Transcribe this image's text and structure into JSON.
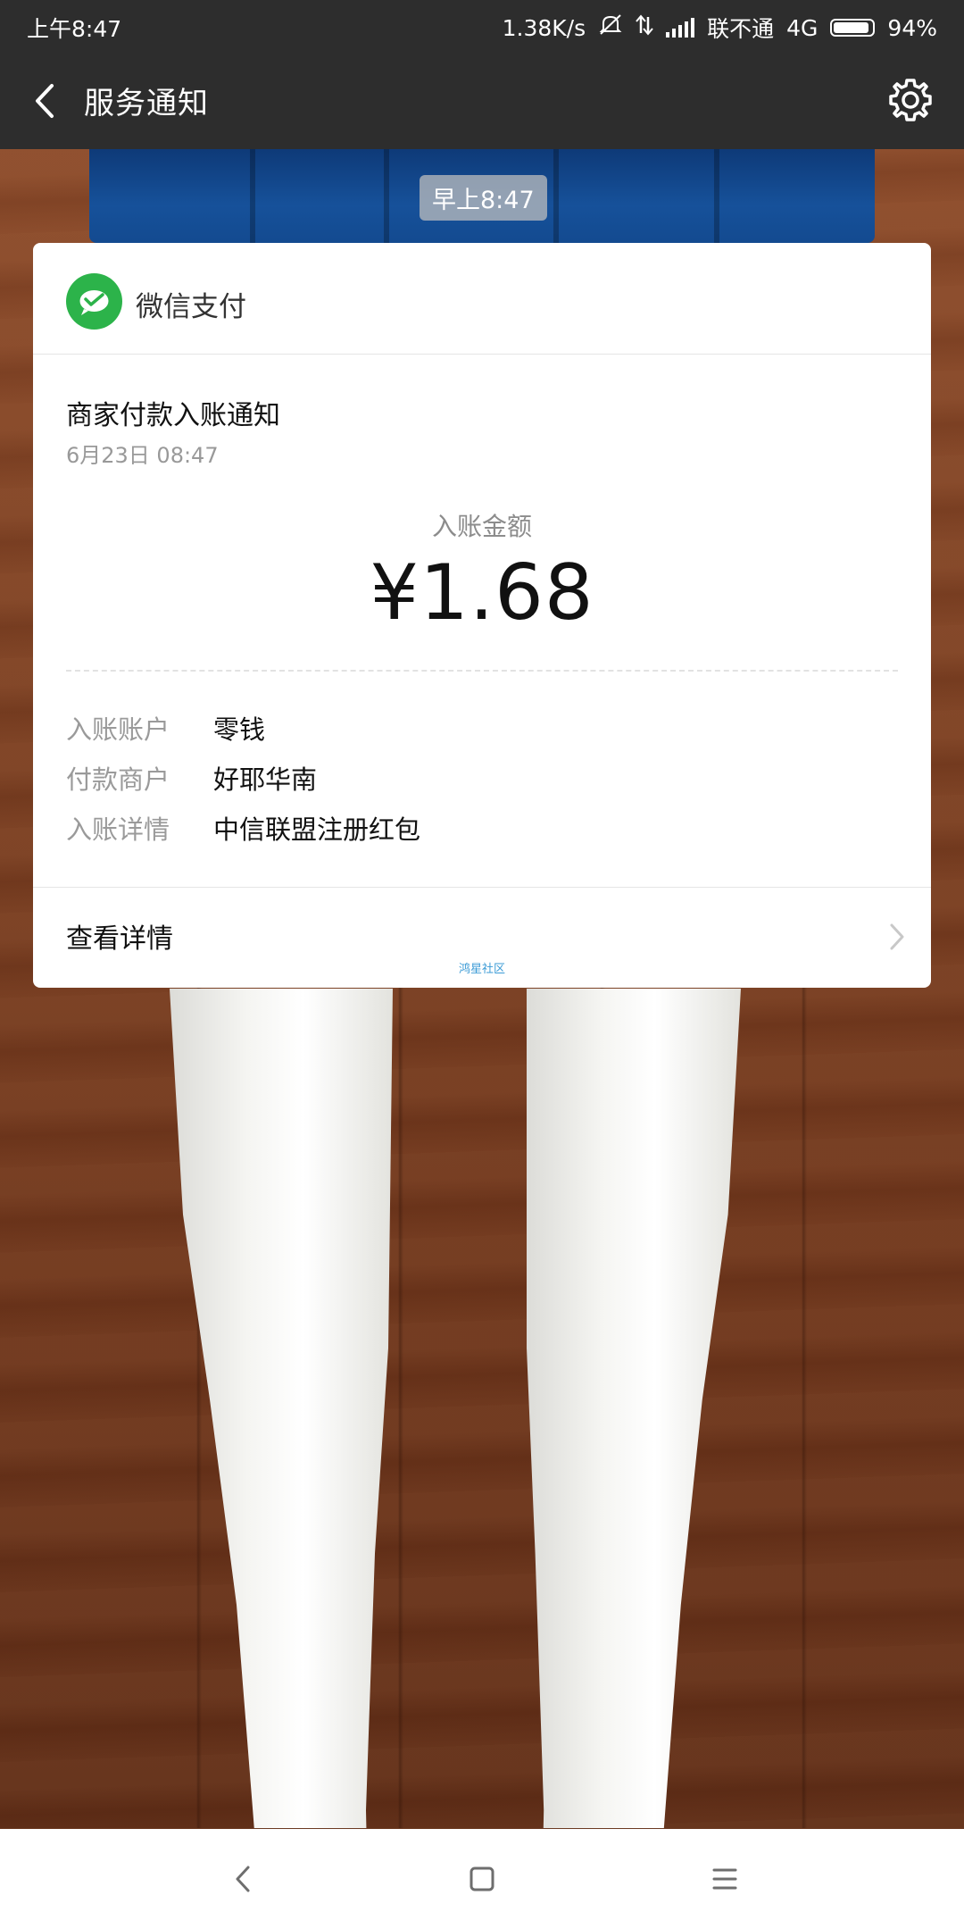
{
  "status_bar": {
    "time": "上午8:47",
    "network_speed": "1.38K/s",
    "carrier": "联不通",
    "network_type": "4G",
    "battery": "94%",
    "battery_level": 0.94,
    "icons": [
      "mute-icon",
      "data-arrows-icon",
      "signal-icon",
      "battery-icon"
    ]
  },
  "nav": {
    "title": "服务通知",
    "back_icon": "back-arrow-icon",
    "settings_icon": "gear-icon"
  },
  "chat": {
    "time_chip": "早上8:47"
  },
  "card": {
    "brand": "微信支付",
    "brand_icon": "wechat-pay-icon",
    "brand_color": "#2cb34a",
    "title": "商家付款入账通知",
    "date": "6月23日  08:47",
    "amount_label": "入账金额",
    "amount": "¥1.68",
    "details": [
      {
        "key": "入账账户",
        "value": "零钱"
      },
      {
        "key": "付款商户",
        "value": "好耶华南"
      },
      {
        "key": "入账详情",
        "value": "中信联盟注册红包"
      }
    ],
    "footer_label": "查看详情",
    "watermark": "鸿星社区"
  },
  "system_nav": {
    "buttons": [
      "back-icon",
      "home-icon",
      "menu-icon"
    ]
  }
}
